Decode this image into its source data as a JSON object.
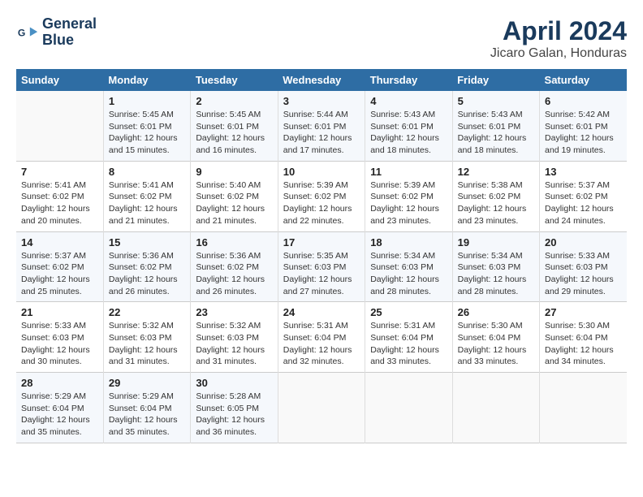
{
  "header": {
    "logo_line1": "General",
    "logo_line2": "Blue",
    "main_title": "April 2024",
    "subtitle": "Jicaro Galan, Honduras"
  },
  "weekdays": [
    "Sunday",
    "Monday",
    "Tuesday",
    "Wednesday",
    "Thursday",
    "Friday",
    "Saturday"
  ],
  "weeks": [
    [
      {
        "num": "",
        "detail": ""
      },
      {
        "num": "1",
        "detail": "Sunrise: 5:45 AM\nSunset: 6:01 PM\nDaylight: 12 hours\nand 15 minutes."
      },
      {
        "num": "2",
        "detail": "Sunrise: 5:45 AM\nSunset: 6:01 PM\nDaylight: 12 hours\nand 16 minutes."
      },
      {
        "num": "3",
        "detail": "Sunrise: 5:44 AM\nSunset: 6:01 PM\nDaylight: 12 hours\nand 17 minutes."
      },
      {
        "num": "4",
        "detail": "Sunrise: 5:43 AM\nSunset: 6:01 PM\nDaylight: 12 hours\nand 18 minutes."
      },
      {
        "num": "5",
        "detail": "Sunrise: 5:43 AM\nSunset: 6:01 PM\nDaylight: 12 hours\nand 18 minutes."
      },
      {
        "num": "6",
        "detail": "Sunrise: 5:42 AM\nSunset: 6:01 PM\nDaylight: 12 hours\nand 19 minutes."
      }
    ],
    [
      {
        "num": "7",
        "detail": "Sunrise: 5:41 AM\nSunset: 6:02 PM\nDaylight: 12 hours\nand 20 minutes."
      },
      {
        "num": "8",
        "detail": "Sunrise: 5:41 AM\nSunset: 6:02 PM\nDaylight: 12 hours\nand 21 minutes."
      },
      {
        "num": "9",
        "detail": "Sunrise: 5:40 AM\nSunset: 6:02 PM\nDaylight: 12 hours\nand 21 minutes."
      },
      {
        "num": "10",
        "detail": "Sunrise: 5:39 AM\nSunset: 6:02 PM\nDaylight: 12 hours\nand 22 minutes."
      },
      {
        "num": "11",
        "detail": "Sunrise: 5:39 AM\nSunset: 6:02 PM\nDaylight: 12 hours\nand 23 minutes."
      },
      {
        "num": "12",
        "detail": "Sunrise: 5:38 AM\nSunset: 6:02 PM\nDaylight: 12 hours\nand 23 minutes."
      },
      {
        "num": "13",
        "detail": "Sunrise: 5:37 AM\nSunset: 6:02 PM\nDaylight: 12 hours\nand 24 minutes."
      }
    ],
    [
      {
        "num": "14",
        "detail": "Sunrise: 5:37 AM\nSunset: 6:02 PM\nDaylight: 12 hours\nand 25 minutes."
      },
      {
        "num": "15",
        "detail": "Sunrise: 5:36 AM\nSunset: 6:02 PM\nDaylight: 12 hours\nand 26 minutes."
      },
      {
        "num": "16",
        "detail": "Sunrise: 5:36 AM\nSunset: 6:02 PM\nDaylight: 12 hours\nand 26 minutes."
      },
      {
        "num": "17",
        "detail": "Sunrise: 5:35 AM\nSunset: 6:03 PM\nDaylight: 12 hours\nand 27 minutes."
      },
      {
        "num": "18",
        "detail": "Sunrise: 5:34 AM\nSunset: 6:03 PM\nDaylight: 12 hours\nand 28 minutes."
      },
      {
        "num": "19",
        "detail": "Sunrise: 5:34 AM\nSunset: 6:03 PM\nDaylight: 12 hours\nand 28 minutes."
      },
      {
        "num": "20",
        "detail": "Sunrise: 5:33 AM\nSunset: 6:03 PM\nDaylight: 12 hours\nand 29 minutes."
      }
    ],
    [
      {
        "num": "21",
        "detail": "Sunrise: 5:33 AM\nSunset: 6:03 PM\nDaylight: 12 hours\nand 30 minutes."
      },
      {
        "num": "22",
        "detail": "Sunrise: 5:32 AM\nSunset: 6:03 PM\nDaylight: 12 hours\nand 31 minutes."
      },
      {
        "num": "23",
        "detail": "Sunrise: 5:32 AM\nSunset: 6:03 PM\nDaylight: 12 hours\nand 31 minutes."
      },
      {
        "num": "24",
        "detail": "Sunrise: 5:31 AM\nSunset: 6:04 PM\nDaylight: 12 hours\nand 32 minutes."
      },
      {
        "num": "25",
        "detail": "Sunrise: 5:31 AM\nSunset: 6:04 PM\nDaylight: 12 hours\nand 33 minutes."
      },
      {
        "num": "26",
        "detail": "Sunrise: 5:30 AM\nSunset: 6:04 PM\nDaylight: 12 hours\nand 33 minutes."
      },
      {
        "num": "27",
        "detail": "Sunrise: 5:30 AM\nSunset: 6:04 PM\nDaylight: 12 hours\nand 34 minutes."
      }
    ],
    [
      {
        "num": "28",
        "detail": "Sunrise: 5:29 AM\nSunset: 6:04 PM\nDaylight: 12 hours\nand 35 minutes."
      },
      {
        "num": "29",
        "detail": "Sunrise: 5:29 AM\nSunset: 6:04 PM\nDaylight: 12 hours\nand 35 minutes."
      },
      {
        "num": "30",
        "detail": "Sunrise: 5:28 AM\nSunset: 6:05 PM\nDaylight: 12 hours\nand 36 minutes."
      },
      {
        "num": "",
        "detail": ""
      },
      {
        "num": "",
        "detail": ""
      },
      {
        "num": "",
        "detail": ""
      },
      {
        "num": "",
        "detail": ""
      }
    ]
  ]
}
